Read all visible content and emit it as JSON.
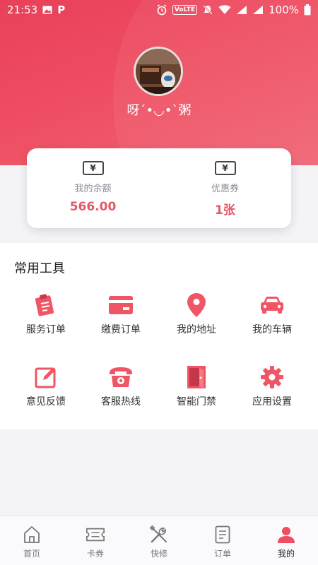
{
  "status_bar": {
    "time": "21:53",
    "battery": "100%",
    "volte": "VoLTE",
    "p_label": "P"
  },
  "profile": {
    "username": "呀´•◡•`粥"
  },
  "wallet": {
    "balance": {
      "label": "我的余额",
      "value": "566.00",
      "icon": "yen-icon"
    },
    "coupon": {
      "label": "优惠券",
      "value": "1张",
      "icon": "yen-icon"
    }
  },
  "tools": {
    "title": "常用工具",
    "items": [
      {
        "label": "服务订单",
        "icon": "clipboard-icon"
      },
      {
        "label": "缴费订单",
        "icon": "card-icon"
      },
      {
        "label": "我的地址",
        "icon": "location-pin-icon"
      },
      {
        "label": "我的车辆",
        "icon": "car-icon"
      },
      {
        "label": "意见反馈",
        "icon": "edit-icon"
      },
      {
        "label": "客服热线",
        "icon": "telephone-icon"
      },
      {
        "label": "智能门禁",
        "icon": "door-icon"
      },
      {
        "label": "应用设置",
        "icon": "gear-icon"
      }
    ]
  },
  "tabbar": {
    "items": [
      {
        "label": "首页",
        "icon": "home-icon"
      },
      {
        "label": "卡券",
        "icon": "ticket-icon"
      },
      {
        "label": "快修",
        "icon": "tools-icon"
      },
      {
        "label": "订单",
        "icon": "document-icon"
      },
      {
        "label": "我的",
        "icon": "user-icon",
        "active": true
      }
    ]
  },
  "colors": {
    "accent": "#ef4d61",
    "value_red": "#e05a66"
  }
}
